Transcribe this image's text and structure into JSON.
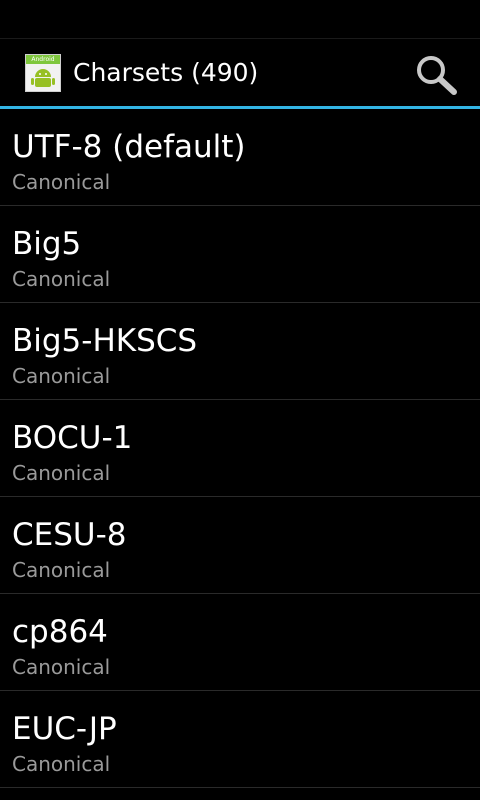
{
  "action_bar": {
    "title": "Charsets (490)",
    "icon_name": "android-app-icon",
    "icon_tag": "Android",
    "search_icon": "search-icon"
  },
  "colors": {
    "accent": "#33b5e5",
    "background": "#000000",
    "secondary_text": "#9a9a9a"
  },
  "charsets": [
    {
      "name": "UTF-8 (default)",
      "type": "Canonical"
    },
    {
      "name": "Big5",
      "type": "Canonical"
    },
    {
      "name": "Big5-HKSCS",
      "type": "Canonical"
    },
    {
      "name": "BOCU-1",
      "type": "Canonical"
    },
    {
      "name": "CESU-8",
      "type": "Canonical"
    },
    {
      "name": "cp864",
      "type": "Canonical"
    },
    {
      "name": "EUC-JP",
      "type": "Canonical"
    }
  ]
}
